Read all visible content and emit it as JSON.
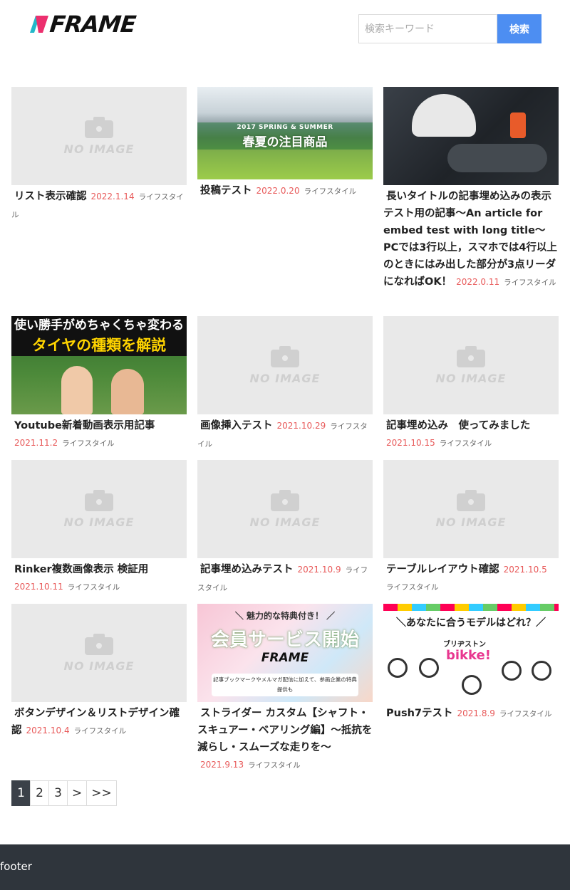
{
  "header": {
    "logo_text": "FRAME",
    "search_placeholder": "検索キーワード",
    "search_button": "検索"
  },
  "no_image_label": "NO IMAGE",
  "articles": [
    {
      "title": "リスト表示確認",
      "date": "2022.1.14",
      "category": "ライフスタイル",
      "thumb": "no-image"
    },
    {
      "title": "投稿テスト",
      "date": "2022.0.20",
      "category": "ライフスタイル",
      "thumb": "mountain",
      "thumb_text_1": "2017 SPRING & SUMMER",
      "thumb_text_2": "春夏の注目商品"
    },
    {
      "title": "長いタイトルの記事埋め込みの表示テスト用の記事〜An article for embed test with long title〜PCでは3行以上，スマホでは4行以上のときにはみ出した部分が3点リーダになればOK！",
      "date": "2022.0.11",
      "category": "ライフスタイル",
      "thumb": "bike"
    },
    {
      "title": "Youtube新着動画表示用記事",
      "date": "2021.11.2",
      "category": "ライフスタイル",
      "thumb": "youtube",
      "thumb_text_1": "使い勝手がめちゃくちゃ変わる",
      "thumb_text_2": "タイヤの種類を解説"
    },
    {
      "title": "画像挿入テスト",
      "date": "2021.10.29",
      "category": "ライフスタイル",
      "thumb": "no-image"
    },
    {
      "title": "記事埋め込み　使ってみました",
      "date": "2021.10.15",
      "category": "ライフスタイル",
      "thumb": "no-image"
    },
    {
      "title": "Rinker複数画像表示 検証用",
      "date": "2021.10.11",
      "category": "ライフスタイル",
      "thumb": "no-image"
    },
    {
      "title": "記事埋め込みテスト",
      "date": "2021.10.9",
      "category": "ライフスタイル",
      "thumb": "no-image"
    },
    {
      "title": "テーブルレイアウト確認",
      "date": "2021.10.5",
      "category": "ライフスタイル",
      "thumb": "no-image"
    },
    {
      "title": "ボタンデザイン＆リストデザイン確認",
      "date": "2021.10.4",
      "category": "ライフスタイル",
      "thumb": "no-image"
    },
    {
      "title": "ストライダー カスタム【シャフト・スキュアー・ベアリング編】〜抵抗を減らし・スムーズな走りを〜",
      "date": "2021.9.13",
      "category": "ライフスタイル",
      "thumb": "member",
      "thumb_text_1": "＼ 魅力的な特典付き！ ／",
      "thumb_text_2": "会員サービス開始",
      "thumb_text_3": "FRAME",
      "thumb_text_4": "記事ブックマークやメルマガ配信に加えて、参画企業の特典提供も"
    },
    {
      "title": "Push7テスト",
      "date": "2021.8.9",
      "category": "ライフスタイル",
      "thumb": "bikke",
      "thumb_text_1": "＼あなたに合うモデルはどれ？／",
      "thumb_text_2": "ブリヂストン",
      "thumb_text_3": "bikke!"
    }
  ],
  "pagination": {
    "pages": [
      "1",
      "2",
      "3",
      ">",
      ">>"
    ],
    "active_index": 0
  },
  "footer": {
    "text": "footer"
  },
  "colors": {
    "accent": "#4d8ef2",
    "date": "#e85a5a",
    "footer_bg": "#2f353c",
    "pager_active": "#3b4149",
    "logo_pink": "#ec2f6e",
    "logo_teal": "#22b8c9"
  }
}
